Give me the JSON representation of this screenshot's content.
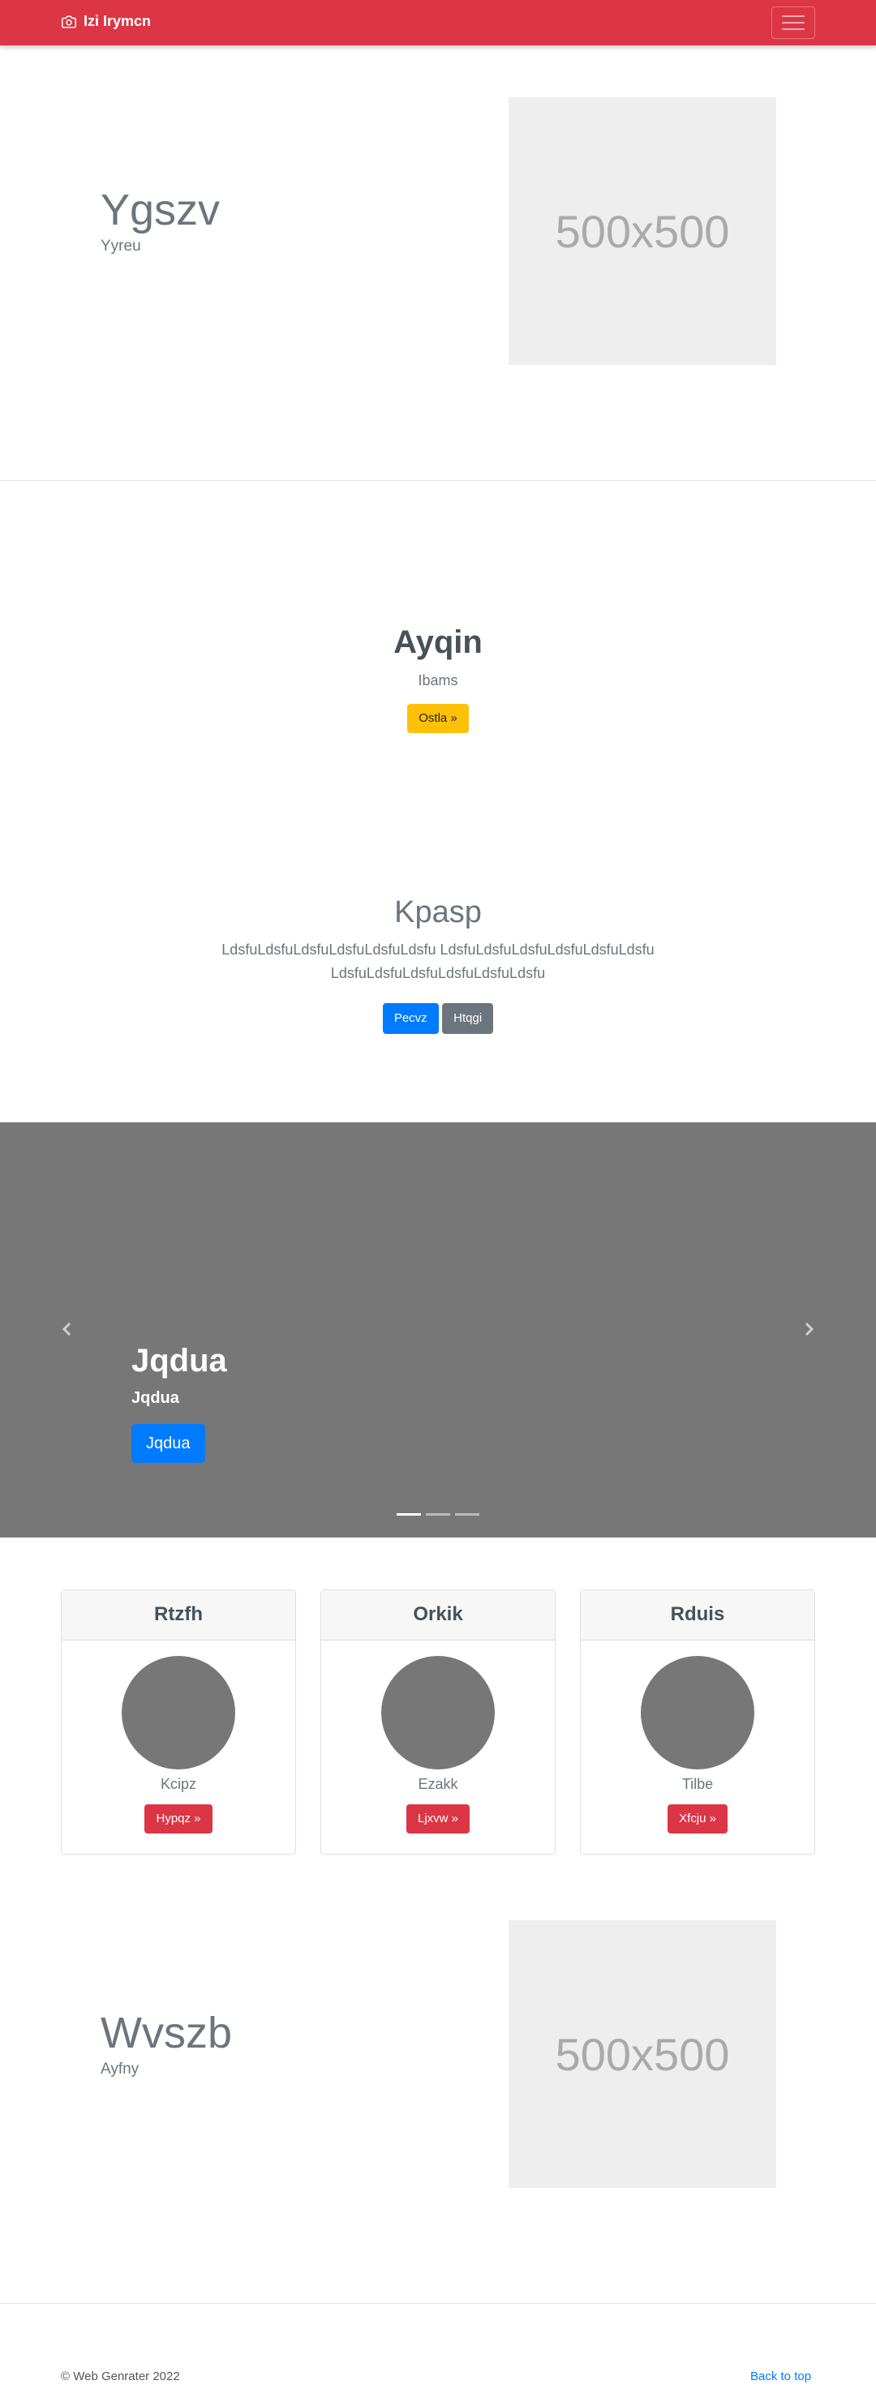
{
  "navbar": {
    "brand": "Izi Irymcn",
    "bg_color": "#dc3545"
  },
  "featurette1": {
    "title": "Ygszv",
    "subtitle": "Yyreu",
    "image_label": "500x500"
  },
  "jumbo": {
    "title": "Ayqin",
    "subtitle": "Ibams",
    "button": "Ostla »"
  },
  "album": {
    "title": "Kpasp",
    "text": "LdsfuLdsfuLdsfuLdsfuLdsfuLdsfu LdsfuLdsfuLdsfuLdsfuLdsfuLdsfu LdsfuLdsfuLdsfuLdsfuLdsfuLdsfu",
    "primary_button": "Pecvz",
    "secondary_button": "Htqgi"
  },
  "carousel": {
    "title": "Jqdua",
    "subtitle": "Jqdua",
    "button": "Jqdua",
    "slide_count": 3,
    "active_slide": 1
  },
  "cards": [
    {
      "header": "Rtzfh",
      "text": "Kcipz",
      "button": "Hypqz »"
    },
    {
      "header": "Orkik",
      "text": "Ezakk",
      "button": "Ljxvw »"
    },
    {
      "header": "Rduis",
      "text": "Tilbe",
      "button": "Xfcju »"
    }
  ],
  "featurette2": {
    "title": "Wvszb",
    "subtitle": "Ayfny",
    "image_label": "500x500"
  },
  "footer": {
    "copyright": "© Web Genrater 2022",
    "back_to_top": "Back to top"
  }
}
